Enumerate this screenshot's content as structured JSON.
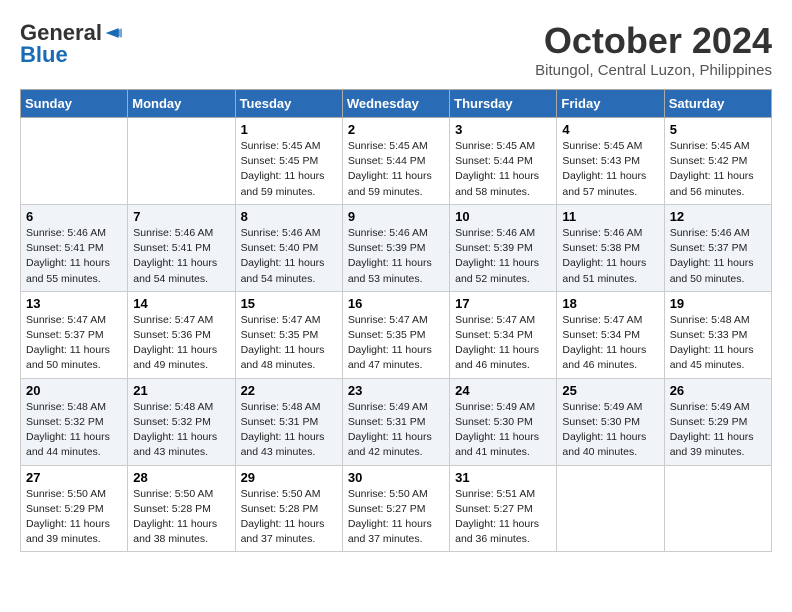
{
  "header": {
    "logo_line1": "General",
    "logo_line2": "Blue",
    "month_title": "October 2024",
    "location": "Bitungol, Central Luzon, Philippines"
  },
  "weekdays": [
    "Sunday",
    "Monday",
    "Tuesday",
    "Wednesday",
    "Thursday",
    "Friday",
    "Saturday"
  ],
  "weeks": [
    [
      {
        "day": "",
        "info": ""
      },
      {
        "day": "",
        "info": ""
      },
      {
        "day": "1",
        "sunrise": "5:45 AM",
        "sunset": "5:45 PM",
        "daylight": "11 hours and 59 minutes."
      },
      {
        "day": "2",
        "sunrise": "5:45 AM",
        "sunset": "5:44 PM",
        "daylight": "11 hours and 59 minutes."
      },
      {
        "day": "3",
        "sunrise": "5:45 AM",
        "sunset": "5:44 PM",
        "daylight": "11 hours and 58 minutes."
      },
      {
        "day": "4",
        "sunrise": "5:45 AM",
        "sunset": "5:43 PM",
        "daylight": "11 hours and 57 minutes."
      },
      {
        "day": "5",
        "sunrise": "5:45 AM",
        "sunset": "5:42 PM",
        "daylight": "11 hours and 56 minutes."
      }
    ],
    [
      {
        "day": "6",
        "sunrise": "5:46 AM",
        "sunset": "5:41 PM",
        "daylight": "11 hours and 55 minutes."
      },
      {
        "day": "7",
        "sunrise": "5:46 AM",
        "sunset": "5:41 PM",
        "daylight": "11 hours and 54 minutes."
      },
      {
        "day": "8",
        "sunrise": "5:46 AM",
        "sunset": "5:40 PM",
        "daylight": "11 hours and 54 minutes."
      },
      {
        "day": "9",
        "sunrise": "5:46 AM",
        "sunset": "5:39 PM",
        "daylight": "11 hours and 53 minutes."
      },
      {
        "day": "10",
        "sunrise": "5:46 AM",
        "sunset": "5:39 PM",
        "daylight": "11 hours and 52 minutes."
      },
      {
        "day": "11",
        "sunrise": "5:46 AM",
        "sunset": "5:38 PM",
        "daylight": "11 hours and 51 minutes."
      },
      {
        "day": "12",
        "sunrise": "5:46 AM",
        "sunset": "5:37 PM",
        "daylight": "11 hours and 50 minutes."
      }
    ],
    [
      {
        "day": "13",
        "sunrise": "5:47 AM",
        "sunset": "5:37 PM",
        "daylight": "11 hours and 50 minutes."
      },
      {
        "day": "14",
        "sunrise": "5:47 AM",
        "sunset": "5:36 PM",
        "daylight": "11 hours and 49 minutes."
      },
      {
        "day": "15",
        "sunrise": "5:47 AM",
        "sunset": "5:35 PM",
        "daylight": "11 hours and 48 minutes."
      },
      {
        "day": "16",
        "sunrise": "5:47 AM",
        "sunset": "5:35 PM",
        "daylight": "11 hours and 47 minutes."
      },
      {
        "day": "17",
        "sunrise": "5:47 AM",
        "sunset": "5:34 PM",
        "daylight": "11 hours and 46 minutes."
      },
      {
        "day": "18",
        "sunrise": "5:47 AM",
        "sunset": "5:34 PM",
        "daylight": "11 hours and 46 minutes."
      },
      {
        "day": "19",
        "sunrise": "5:48 AM",
        "sunset": "5:33 PM",
        "daylight": "11 hours and 45 minutes."
      }
    ],
    [
      {
        "day": "20",
        "sunrise": "5:48 AM",
        "sunset": "5:32 PM",
        "daylight": "11 hours and 44 minutes."
      },
      {
        "day": "21",
        "sunrise": "5:48 AM",
        "sunset": "5:32 PM",
        "daylight": "11 hours and 43 minutes."
      },
      {
        "day": "22",
        "sunrise": "5:48 AM",
        "sunset": "5:31 PM",
        "daylight": "11 hours and 43 minutes."
      },
      {
        "day": "23",
        "sunrise": "5:49 AM",
        "sunset": "5:31 PM",
        "daylight": "11 hours and 42 minutes."
      },
      {
        "day": "24",
        "sunrise": "5:49 AM",
        "sunset": "5:30 PM",
        "daylight": "11 hours and 41 minutes."
      },
      {
        "day": "25",
        "sunrise": "5:49 AM",
        "sunset": "5:30 PM",
        "daylight": "11 hours and 40 minutes."
      },
      {
        "day": "26",
        "sunrise": "5:49 AM",
        "sunset": "5:29 PM",
        "daylight": "11 hours and 39 minutes."
      }
    ],
    [
      {
        "day": "27",
        "sunrise": "5:50 AM",
        "sunset": "5:29 PM",
        "daylight": "11 hours and 39 minutes."
      },
      {
        "day": "28",
        "sunrise": "5:50 AM",
        "sunset": "5:28 PM",
        "daylight": "11 hours and 38 minutes."
      },
      {
        "day": "29",
        "sunrise": "5:50 AM",
        "sunset": "5:28 PM",
        "daylight": "11 hours and 37 minutes."
      },
      {
        "day": "30",
        "sunrise": "5:50 AM",
        "sunset": "5:27 PM",
        "daylight": "11 hours and 37 minutes."
      },
      {
        "day": "31",
        "sunrise": "5:51 AM",
        "sunset": "5:27 PM",
        "daylight": "11 hours and 36 minutes."
      },
      {
        "day": "",
        "info": ""
      },
      {
        "day": "",
        "info": ""
      }
    ]
  ],
  "labels": {
    "sunrise": "Sunrise:",
    "sunset": "Sunset:",
    "daylight": "Daylight:"
  }
}
